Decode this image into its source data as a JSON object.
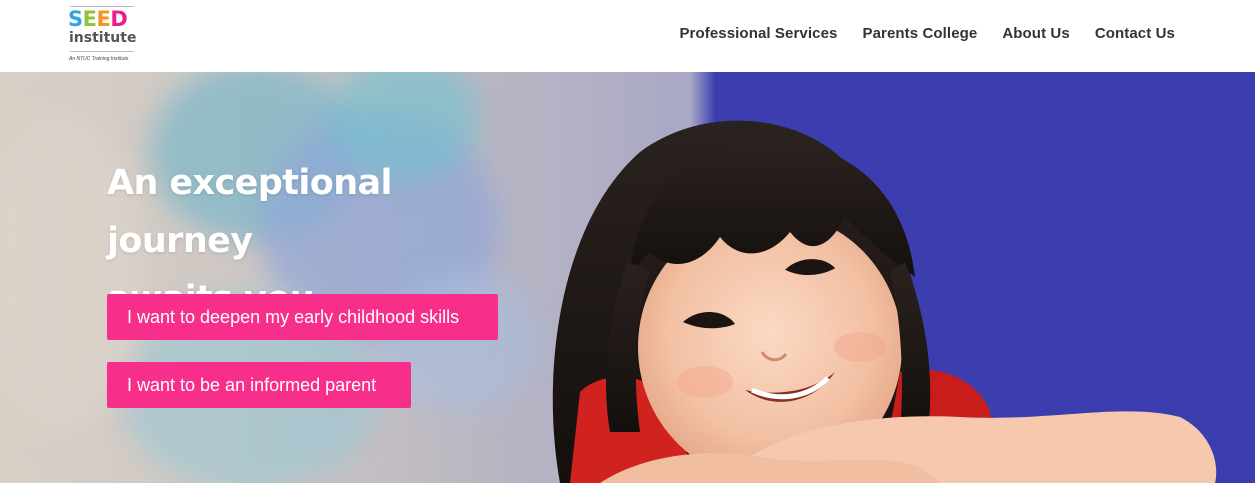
{
  "brand": {
    "name_letters": [
      "S",
      "E",
      "E",
      "D"
    ],
    "name_colors": [
      "#2fa3e6",
      "#8bc53f",
      "#f7941d",
      "#ec1c8c"
    ],
    "subtitle": "institute",
    "tagline": "An NTUC Training Institute"
  },
  "nav": {
    "items": [
      {
        "label": "Professional Services"
      },
      {
        "label": "Parents College"
      },
      {
        "label": "About Us"
      },
      {
        "label": "Contact Us"
      }
    ]
  },
  "hero": {
    "headline_line1": "An exceptional journey",
    "headline_line2": "awaits you",
    "cta_primary": "I want to deepen my early childhood skills",
    "cta_secondary": "I want to be an informed parent",
    "accent_color": "#f72f8b",
    "image_subject": "smiling-child-photo"
  }
}
